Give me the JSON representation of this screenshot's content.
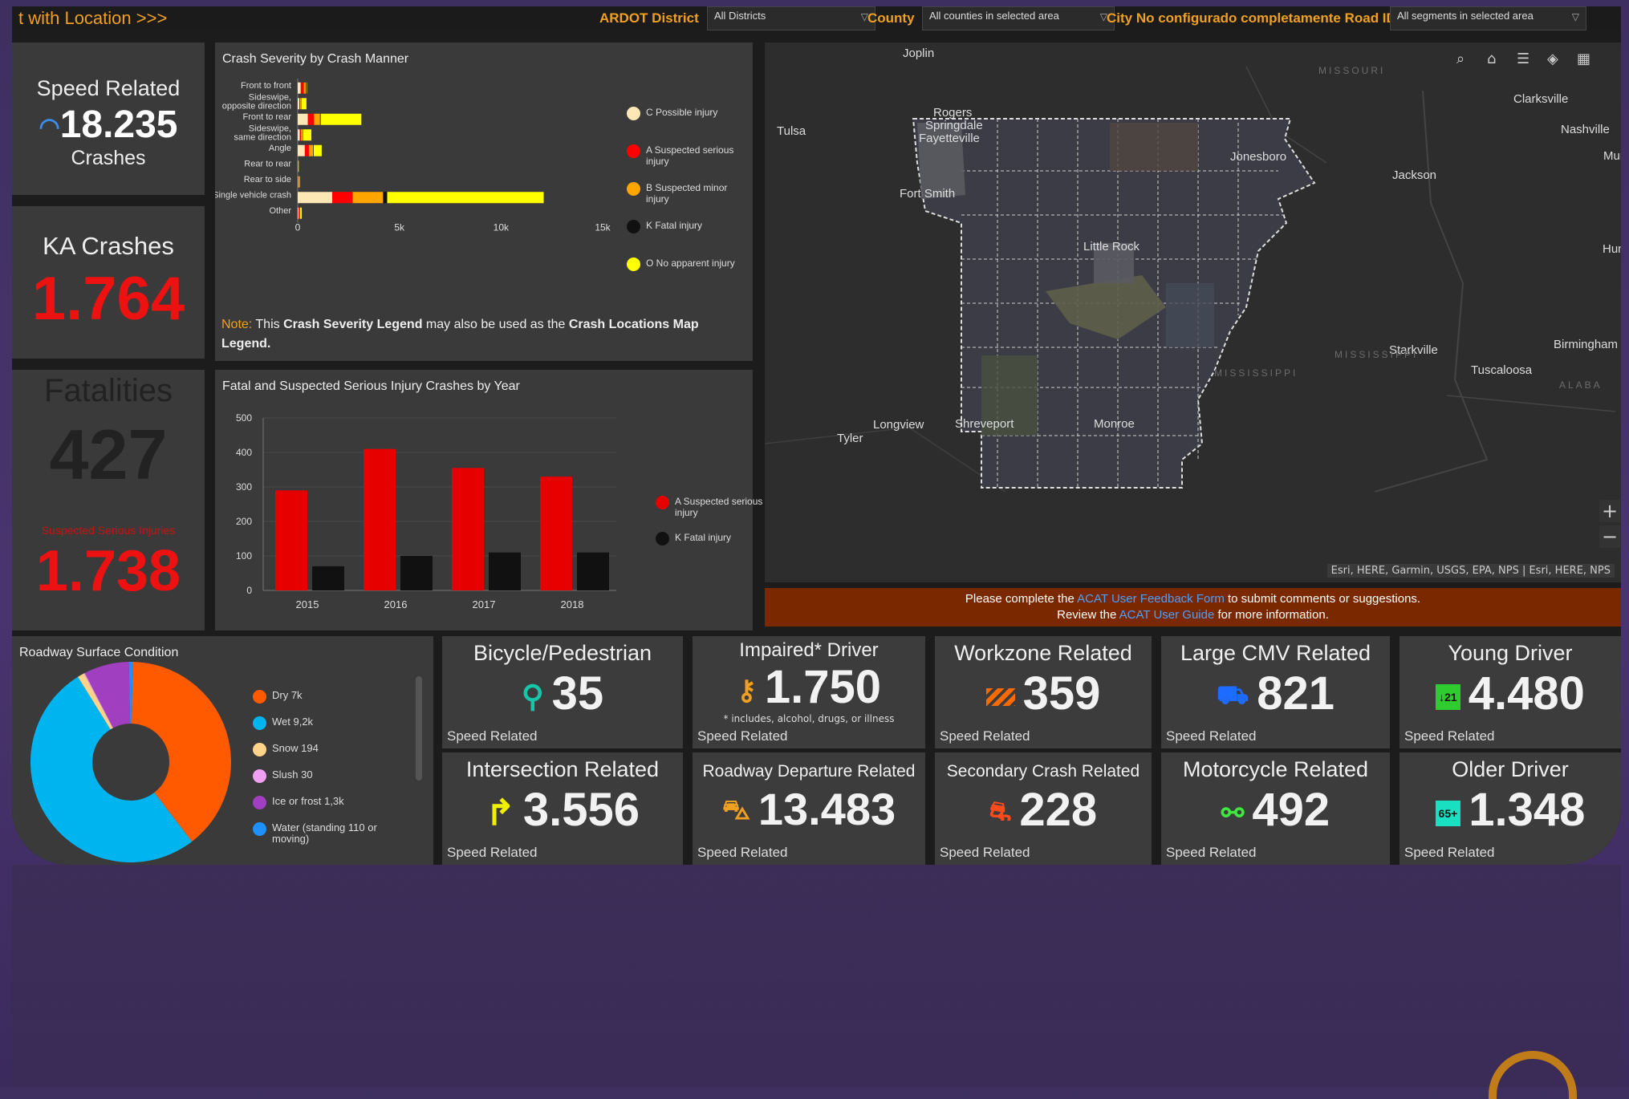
{
  "topbar": {
    "title_fragment": "t with Location >>>",
    "district_label": "ARDOT District",
    "district_value": "All Districts",
    "county_label": "County",
    "county_value": "All counties in selected area",
    "city_label": "City No configurado completamente Road ID",
    "road_value": "All segments in selected area"
  },
  "speed_related": {
    "title": "Speed Related",
    "value": "18.235",
    "sub": "Crashes"
  },
  "ka_crashes": {
    "title": "KA Crashes",
    "value": "1.764"
  },
  "fatalities": {
    "title": "Fatalities",
    "value": "427",
    "ssi_label": "Suspected Serious Injuries",
    "ssi_value": "1.738"
  },
  "severity_chart": {
    "title": "Crash Severity by Crash Manner",
    "note_prefix": "Note:",
    "note_text_1": " This ",
    "note_bold_1": "Crash Severity Legend",
    "note_text_2": " may also be used as the ",
    "note_bold_2": "Crash Locations Map Legend",
    "note_end": ".",
    "legend": [
      {
        "label": "C Possible injury",
        "color": "#fde7b5"
      },
      {
        "label": "A Suspected serious injury",
        "color": "#ff0000"
      },
      {
        "label": "B Suspected minor injury",
        "color": "#ffa500"
      },
      {
        "label": "K Fatal injury",
        "color": "#111111"
      },
      {
        "label": "O No apparent injury",
        "color": "#ffff00"
      }
    ]
  },
  "year_chart": {
    "title": "Fatal and Suspected Serious Injury Crashes by Year",
    "legend": [
      {
        "label": "A Suspected serious injury",
        "color": "#e60000"
      },
      {
        "label": "K Fatal injury",
        "color": "#111111"
      }
    ]
  },
  "map": {
    "cities": [
      "Joplin",
      "Clarksville",
      "Nashville",
      "Murfre",
      "Tulsa",
      "Rogers",
      "Springdale",
      "Fayetteville",
      "Jonesboro",
      "Jackson",
      "Fort Smith",
      "Little Rock",
      "Huntsvi",
      "Birmingham",
      "Starkville",
      "Tuscaloosa",
      "Longview",
      "Shreveport",
      "Monroe",
      "Tyler"
    ],
    "states": [
      "MISSOURI",
      "MISSISSIPPI",
      "MISSISSIPPI",
      "ALABA"
    ],
    "attribution": "Esri, HERE, Garmin, USGS, EPA, NPS | Esri, HERE, NPS",
    "zoom_in": "+",
    "zoom_out": "−"
  },
  "feedback": {
    "line1_a": "Please complete the ",
    "line1_link": "ACAT User Feedback Form",
    "line1_b": " to submit comments or suggestions.",
    "line2_a": "Review the ",
    "line2_link": "ACAT User Guide",
    "line2_b": " for more information."
  },
  "surface": {
    "title": "Roadway Surface Condition",
    "legend": [
      {
        "label": "Dry  7k",
        "color": "#ff5a00"
      },
      {
        "label": "Wet  9,2k",
        "color": "#00b4f0"
      },
      {
        "label": "Snow  194",
        "color": "#ffd38a"
      },
      {
        "label": "Slush  30",
        "color": "#f0a0f0"
      },
      {
        "label": "Ice or frost  1,3k",
        "color": "#a040c0"
      },
      {
        "label": "Water (standing  110 or moving)",
        "color": "#1e90ff"
      }
    ]
  },
  "tiles": {
    "bike": {
      "title": "Bicycle/Pedestrian",
      "value": "35",
      "sub": "Speed Related"
    },
    "impaired": {
      "title": "Impaired* Driver",
      "value": "1.750",
      "note": "* includes, alcohol, drugs, or illness",
      "sub": "Speed Related"
    },
    "workzone": {
      "title": "Workzone Related",
      "value": "359",
      "sub": "Speed Related"
    },
    "cmv": {
      "title": "Large CMV Related",
      "value": "821",
      "sub": "Speed Related"
    },
    "young": {
      "title": "Young Driver",
      "value": "4.480",
      "icon_text": "↓21",
      "sub": "Speed Related"
    },
    "intersection": {
      "title": "Intersection Related",
      "value": "3.556",
      "sub": "Speed Related"
    },
    "departure": {
      "title": "Roadway Departure Related",
      "value": "13.483",
      "sub": "Speed Related"
    },
    "secondary": {
      "title": "Secondary Crash Related",
      "value": "228",
      "sub": "Speed Related"
    },
    "motorcycle": {
      "title": "Motorcycle Related",
      "value": "492",
      "sub": "Speed Related"
    },
    "older": {
      "title": "Older Driver",
      "value": "1.348",
      "icon_text": "65+",
      "sub": "Speed Related"
    }
  },
  "chart_data": [
    {
      "type": "bar",
      "orientation": "horizontal",
      "stacked": true,
      "title": "Crash Severity by Crash Manner",
      "categories": [
        "Front to front",
        "Sideswipe, opposite direction",
        "Front to rear",
        "Sideswipe, same direction",
        "Angle",
        "Rear to rear",
        "Rear to side",
        "Single vehicle crash",
        "Other"
      ],
      "series": [
        {
          "name": "C Possible injury",
          "values": [
            150,
            80,
            500,
            100,
            350,
            20,
            30,
            1700,
            40
          ]
        },
        {
          "name": "A Suspected serious injury",
          "values": [
            150,
            40,
            300,
            60,
            200,
            10,
            20,
            1000,
            40
          ]
        },
        {
          "name": "B Suspected minor injury",
          "values": [
            100,
            50,
            300,
            100,
            200,
            10,
            20,
            1500,
            30
          ]
        },
        {
          "name": "K Fatal injury",
          "values": [
            30,
            10,
            30,
            10,
            30,
            2,
            2,
            200,
            10
          ]
        },
        {
          "name": "O No apparent injury",
          "values": [
            20,
            250,
            2000,
            400,
            400,
            10,
            30,
            7700,
            80
          ]
        }
      ],
      "xlim": [
        0,
        15000
      ],
      "ticks": [
        "0",
        "5k",
        "10k",
        "15k"
      ]
    },
    {
      "type": "bar",
      "title": "Fatal and Suspected Serious Injury Crashes by Year",
      "categories": [
        "2015",
        "2016",
        "2017",
        "2018"
      ],
      "series": [
        {
          "name": "A Suspected serious injury",
          "values": [
            290,
            410,
            355,
            330
          ]
        },
        {
          "name": "K Fatal injury",
          "values": [
            70,
            100,
            110,
            110
          ]
        }
      ],
      "ylim": [
        0,
        500
      ],
      "yticks": [
        "0",
        "100",
        "200",
        "300",
        "400",
        "500"
      ]
    },
    {
      "type": "pie",
      "donut": true,
      "title": "Roadway Surface Condition",
      "labels": [
        "Dry",
        "Wet",
        "Snow",
        "Slush",
        "Ice or frost",
        "Water (standing or moving)"
      ],
      "values": [
        7000,
        9200,
        194,
        30,
        1300,
        110
      ]
    }
  ]
}
